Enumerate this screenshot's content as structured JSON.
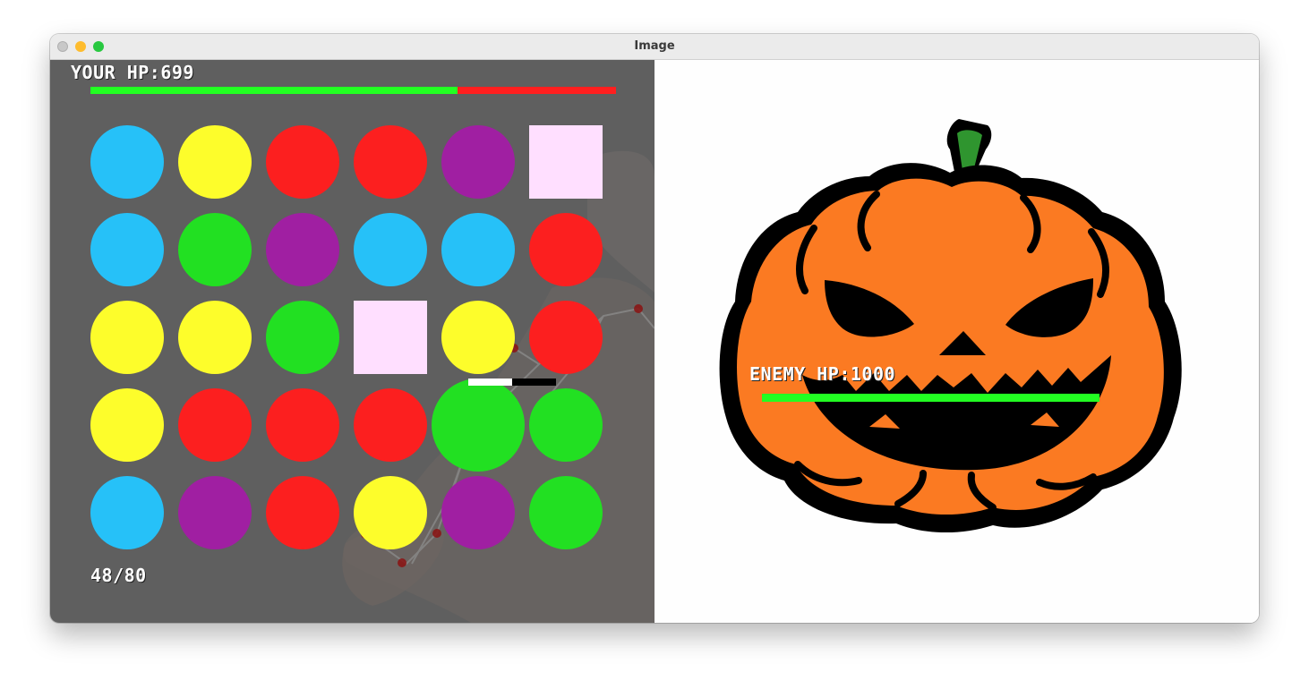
{
  "window": {
    "title": "Image"
  },
  "player": {
    "hp_label": "YOUR HP:699",
    "hp_current": 699,
    "hp_max": 1000
  },
  "board": {
    "colors": {
      "blue": "#26c1f8",
      "yellow": "#fdfd2b",
      "red": "#fc1f1f",
      "purple": "#a01fa2",
      "green": "#22e022",
      "pink": "#ffdfff"
    },
    "grid": [
      [
        "blue",
        "yellow",
        "red",
        "red",
        "purple",
        "pink"
      ],
      [
        "blue",
        "green",
        "purple",
        "blue",
        "blue",
        "red"
      ],
      [
        "yellow",
        "yellow",
        "green",
        "pink",
        "yellow",
        "red"
      ],
      [
        "yellow",
        "red",
        "red",
        "red",
        "green",
        "green"
      ],
      [
        "blue",
        "purple",
        "red",
        "yellow",
        "purple",
        "green"
      ]
    ],
    "selected": {
      "row": 3,
      "col": 4
    },
    "hold_progress": 0.5
  },
  "counter": {
    "text": "48/80"
  },
  "enemy": {
    "hp_label": "ENEMY HP:1000",
    "hp_current": 1000,
    "hp_max": 1000,
    "icon": "jack-o-lantern-icon"
  }
}
